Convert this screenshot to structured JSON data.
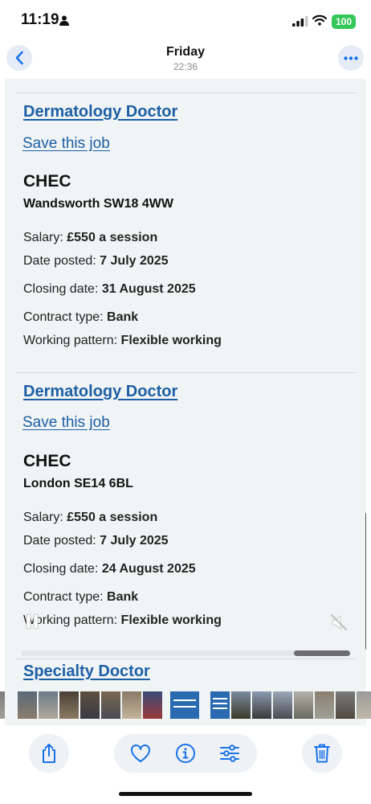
{
  "status_bar": {
    "time": "11:19",
    "battery": "100"
  },
  "nav": {
    "title": "Friday",
    "subtitle": "22:36"
  },
  "jobs": [
    {
      "title": "Dermatology Doctor",
      "save_label": "Save this job",
      "employer": "CHEC",
      "location": "Wandsworth SW18 4WW",
      "salary_label": "Salary: ",
      "salary": "£550 a session",
      "posted_label": "Date posted: ",
      "posted": "7 July 2025",
      "closing_label": "Closing date: ",
      "closing": "31 August 2025",
      "contract_label": "Contract type: ",
      "contract": "Bank",
      "pattern_label": "Working pattern: ",
      "pattern": "Flexible working"
    },
    {
      "title": "Dermatology Doctor",
      "save_label": "Save this job",
      "employer": "CHEC",
      "location": "London SE14 6BL",
      "salary_label": "Salary: ",
      "salary": "£550 a session",
      "posted_label": "Date posted: ",
      "posted": "7 July 2025",
      "closing_label": "Closing date: ",
      "closing": "24 August 2025",
      "contract_label": "Contract type: ",
      "contract": "Bank",
      "pattern_label": "Working pattern: ",
      "pattern": "Flexible working"
    },
    {
      "title": "Specialty Doctor"
    }
  ],
  "video": {
    "progress": 0.83
  },
  "colors": {
    "link": "#1d5fa5",
    "accent": "#1a73e8",
    "battery": "#34c759",
    "viewer_bg": "#f0f4f5"
  },
  "toolbar": {
    "icons": [
      "share-icon",
      "heart-icon",
      "info-icon",
      "sliders-icon",
      "trash-icon"
    ]
  }
}
